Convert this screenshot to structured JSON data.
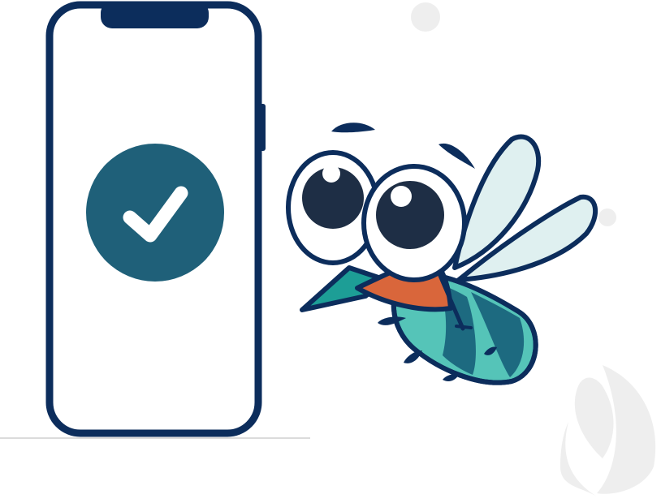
{
  "scene": {
    "colors": {
      "outline": "#0c2d5c",
      "check_circle": "#1f6079",
      "check_mark": "#ffffff",
      "mosquito_teal_dark": "#1d6a80",
      "mosquito_teal_light": "#55c4b8",
      "mosquito_beak": "#d9663b",
      "wing_fill": "#dff0f0",
      "decoration_grey": "#eeeeee"
    },
    "icons": {
      "phone": "smartphone-icon",
      "check": "check-circle-icon",
      "mascot": "mosquito-illustration"
    }
  }
}
